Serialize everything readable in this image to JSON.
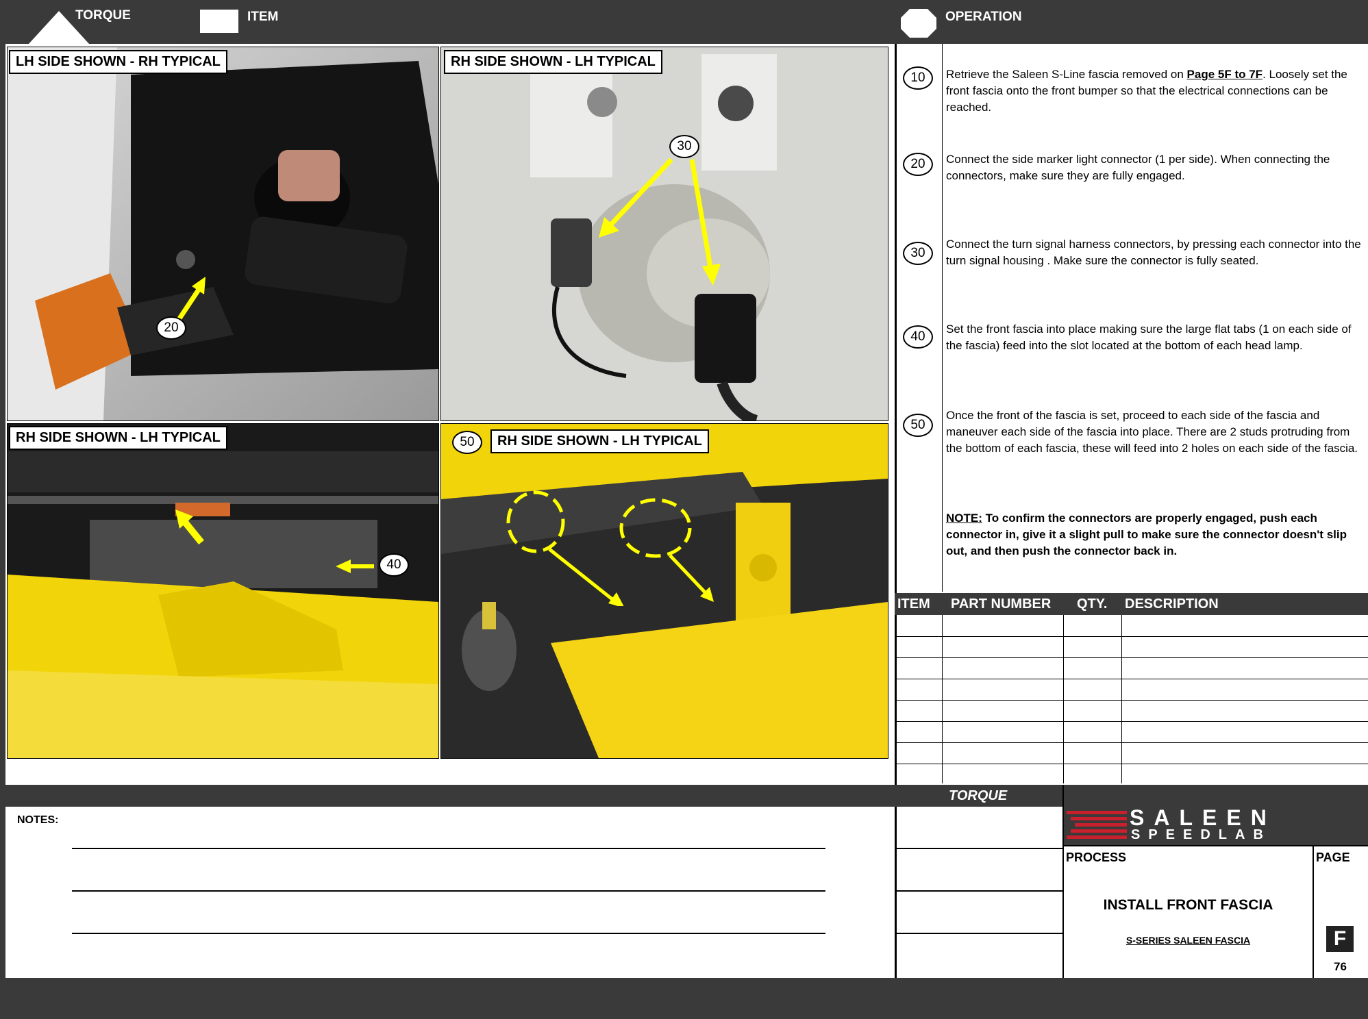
{
  "header": {
    "torque_label": "TORQUE",
    "item_label": "ITEM",
    "operation_label": "OPERATION"
  },
  "photos": {
    "p1_caption": "LH SIDE SHOWN - RH TYPICAL",
    "p2_caption": "RH SIDE SHOWN - LH TYPICAL",
    "p3_caption": "RH SIDE SHOWN - LH TYPICAL",
    "p4_caption": "RH SIDE SHOWN - LH TYPICAL",
    "p1_callout": "20",
    "p2_callout": "30",
    "p3_callout": "40",
    "p4_callout": "50"
  },
  "steps": [
    {
      "num": "10",
      "pre": "Retrieve the Saleen S-Line fascia removed on ",
      "link": "Page 5F to 7F",
      "post": ".  Loosely set the front fascia onto the front bumper so that the electrical connections can be reached."
    },
    {
      "num": "20",
      "text": "Connect the side marker light connector (1 per side).  When connecting the connectors, make sure they are fully engaged."
    },
    {
      "num": "30",
      "text": "Connect the turn signal harness connectors, by pressing each connector into the turn signal housing .  Make sure the connector is fully seated."
    },
    {
      "num": "40",
      "text": "Set the front fascia into place making sure the large flat tabs (1 on each side of the fascia) feed into the slot located at the bottom of each head lamp."
    },
    {
      "num": "50",
      "text": "Once the front of the fascia is set, proceed to each side of the fascia and maneuver each side of the fascia into place.  There are 2 studs protruding from the bottom of each fascia, these will feed into 2 holes on each side of the fascia."
    }
  ],
  "note": {
    "label": "NOTE:",
    "text": " To confirm the connectors are properly engaged, push each connector in, give it a slight pull to make sure the connector doesn't slip out, and then push the connector back in."
  },
  "parts_table": {
    "headers": [
      "ITEM",
      "PART NUMBER",
      "QTY.",
      "DESCRIPTION"
    ],
    "rows": 8
  },
  "footer": {
    "notes_label": "NOTES:",
    "torque_label": "TORQUE",
    "brand_top": "SALEEN",
    "brand_bottom": "SPEEDLAB",
    "process_label": "PROCESS",
    "page_label": "PAGE",
    "process_title": "INSTALL FRONT FASCIA",
    "process_subtitle": "S-SERIES SALEEN FASCIA",
    "page_letter": "F",
    "page_number": "76"
  },
  "colors": {
    "header_bg": "#3a3a3a",
    "arrow_yellow": "#ffff00",
    "brand_red": "#c8202c",
    "fascia_yellow": "#f2d40a"
  }
}
